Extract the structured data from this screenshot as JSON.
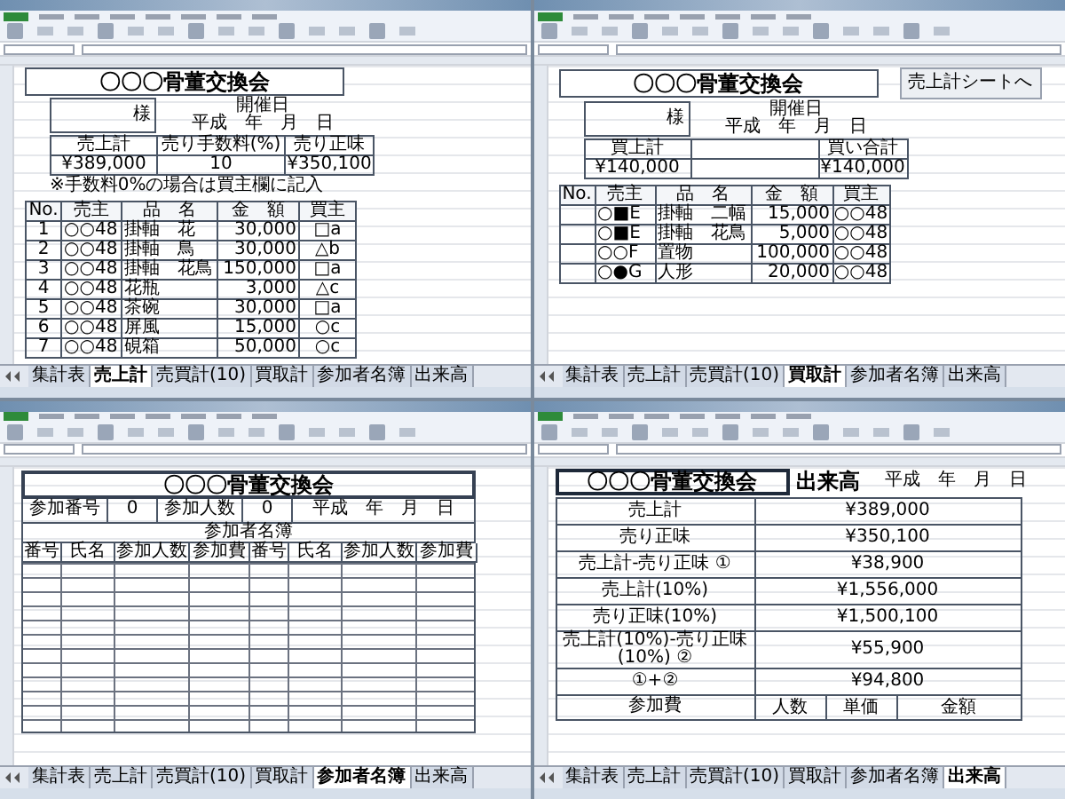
{
  "windows": [
    {
      "kind": "sales",
      "title": "〇〇〇骨董交換会",
      "date_label": "開催日",
      "date": "平成　年　月　日",
      "customer_suffix": "様",
      "summary": [
        {
          "header": "売上計",
          "value": "¥389,000"
        },
        {
          "header": "売り手数料(%)",
          "value": "10"
        },
        {
          "header": "売り正味",
          "value": "¥350,100"
        }
      ],
      "note": "※手数料0%の場合は買主欄に記入",
      "columns": [
        "No.",
        "売主",
        "品　名",
        "金　額",
        "買主"
      ],
      "rows": [
        [
          "1",
          "○○48",
          "掛軸　花",
          "30,000",
          "□a"
        ],
        [
          "2",
          "○○48",
          "掛軸　鳥",
          "30,000",
          "△b"
        ],
        [
          "3",
          "○○48",
          "掛軸　花鳥",
          "150,000",
          "□a"
        ],
        [
          "4",
          "○○48",
          "花瓶",
          "3,000",
          "△c"
        ],
        [
          "5",
          "○○48",
          "茶碗",
          "30,000",
          "□a"
        ],
        [
          "6",
          "○○48",
          "屏風",
          "15,000",
          "○c"
        ],
        [
          "7",
          "○○48",
          "硯箱",
          "50,000",
          "○c"
        ]
      ],
      "tabs": [
        {
          "label": "集計表",
          "selected": false
        },
        {
          "label": "売上計",
          "selected": true
        },
        {
          "label": "売買計(10)",
          "selected": false
        },
        {
          "label": "買取計",
          "selected": false
        },
        {
          "label": "参加者名簿",
          "selected": false
        },
        {
          "label": "出来高",
          "selected": false
        }
      ]
    },
    {
      "kind": "purchase",
      "title": "〇〇〇骨董交換会",
      "button": "売上計シートへ",
      "date_label": "開催日",
      "date": "平成　年　月　日",
      "customer_suffix": "様",
      "summary": [
        {
          "header": "買上計",
          "value": "¥140,000"
        },
        {
          "header": "買い合計",
          "value": "¥140,000"
        }
      ],
      "columns": [
        "No.",
        "売主",
        "品　名",
        "金　額",
        "買主"
      ],
      "rows": [
        [
          "",
          "○■E",
          "掛軸　二幅",
          "15,000",
          "○○48"
        ],
        [
          "",
          "○■E",
          "掛軸　花鳥",
          "5,000",
          "○○48"
        ],
        [
          "",
          "○○F",
          "置物",
          "100,000",
          "○○48"
        ],
        [
          "",
          "○●G",
          "人形",
          "20,000",
          "○○48"
        ]
      ],
      "tabs": [
        {
          "label": "集計表",
          "selected": false
        },
        {
          "label": "売上計",
          "selected": false
        },
        {
          "label": "売買計(10)",
          "selected": false
        },
        {
          "label": "買取計",
          "selected": true
        },
        {
          "label": "参加者名簿",
          "selected": false
        },
        {
          "label": "出来高",
          "selected": false
        }
      ]
    },
    {
      "kind": "roster",
      "title": "〇〇〇骨董交換会",
      "fields": [
        {
          "label": "参加番号",
          "value": "0"
        },
        {
          "label": "参加人数",
          "value": "0"
        }
      ],
      "date": "平成　年　月　日",
      "list_title": "参加者名簿",
      "columns": [
        "番号",
        "氏名",
        "参加人数",
        "参加費",
        "番号",
        "氏名",
        "参加人数",
        "参加費"
      ],
      "tabs": [
        {
          "label": "集計表",
          "selected": false
        },
        {
          "label": "売上計",
          "selected": false
        },
        {
          "label": "売買計(10)",
          "selected": false
        },
        {
          "label": "買取計",
          "selected": false
        },
        {
          "label": "参加者名簿",
          "selected": true
        },
        {
          "label": "出来高",
          "selected": false
        }
      ]
    },
    {
      "kind": "yield",
      "title": "〇〇〇骨董交換会",
      "heading": "出来高",
      "date": "平成　年　月　日",
      "items": [
        {
          "label": "売上計",
          "value": "¥389,000"
        },
        {
          "label": "売り正味",
          "value": "¥350,100"
        },
        {
          "label": "売上計-売り正味 ①",
          "value": "¥38,900"
        },
        {
          "label": "売上計(10%)",
          "value": "¥1,556,000"
        },
        {
          "label": "売り正味(10%)",
          "value": "¥1,500,100"
        },
        {
          "label": "売上計(10%)-売り正味(10%) ②",
          "value": "¥55,900"
        },
        {
          "label": "①+②",
          "value": "¥94,800"
        }
      ],
      "fee": {
        "label": "参加費",
        "columns": [
          "人数",
          "単価",
          "金額"
        ]
      },
      "tabs": [
        {
          "label": "集計表",
          "selected": false
        },
        {
          "label": "売上計",
          "selected": false
        },
        {
          "label": "売買計(10)",
          "selected": false
        },
        {
          "label": "買取計",
          "selected": false
        },
        {
          "label": "参加者名簿",
          "selected": false
        },
        {
          "label": "出来高",
          "selected": true
        }
      ]
    }
  ]
}
